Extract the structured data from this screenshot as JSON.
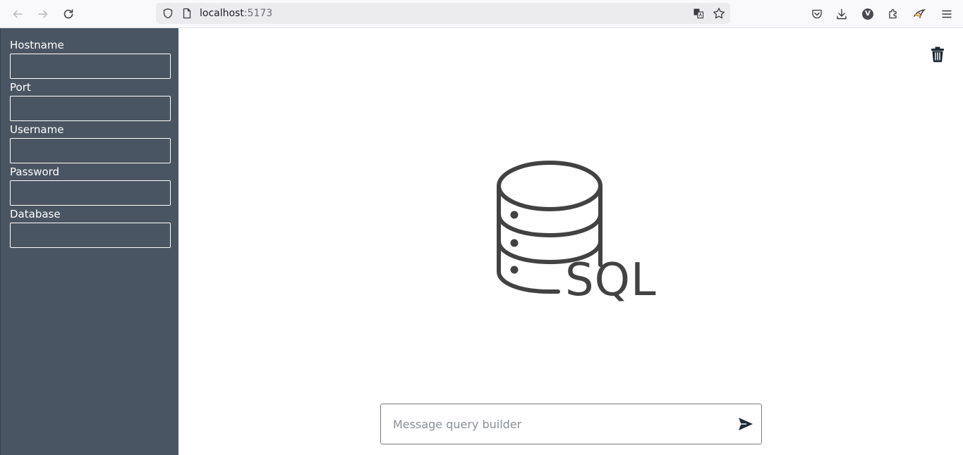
{
  "browser": {
    "url_host": "localhost",
    "url_port": ":5173",
    "profile_initial": "V"
  },
  "sidebar": {
    "fields": [
      {
        "label": "Hostname",
        "value": ""
      },
      {
        "label": "Port",
        "value": ""
      },
      {
        "label": "Username",
        "value": ""
      },
      {
        "label": "Password",
        "value": ""
      },
      {
        "label": "Database",
        "value": ""
      }
    ]
  },
  "main": {
    "logo_text": "SQL",
    "message": {
      "placeholder": "Message query builder",
      "value": ""
    }
  },
  "colors": {
    "sidebar_bg": "#4a5563",
    "icon_dark": "#424242",
    "trash": "#1f2937"
  },
  "icons": {
    "back": "arrow-left-icon",
    "forward": "arrow-right-icon",
    "reload": "reload-icon",
    "trash": "trash-icon",
    "send": "send-icon",
    "logo": "database-sql-icon"
  }
}
